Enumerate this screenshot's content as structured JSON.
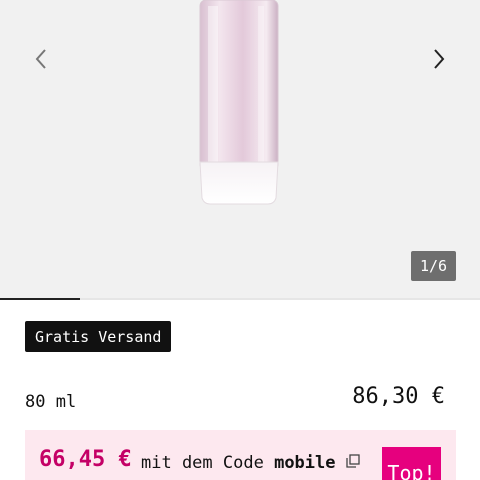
{
  "gallery": {
    "image_icon": "perfume-bottle-image",
    "prev_icon": "chevron-left-icon",
    "next_icon": "chevron-right-icon",
    "counter": "1/6",
    "current_index": 1,
    "total_images": 6
  },
  "badge": {
    "label": "Gratis Versand"
  },
  "product": {
    "size": "80 ml",
    "price": "86,30 €"
  },
  "promo": {
    "price": "66,45 €",
    "text_prefix": "mit dem Code",
    "code": "mobile",
    "copy_icon": "copy-icon",
    "button_label": "Top!",
    "background": "#fde8ef",
    "accent": "#e6007e"
  }
}
